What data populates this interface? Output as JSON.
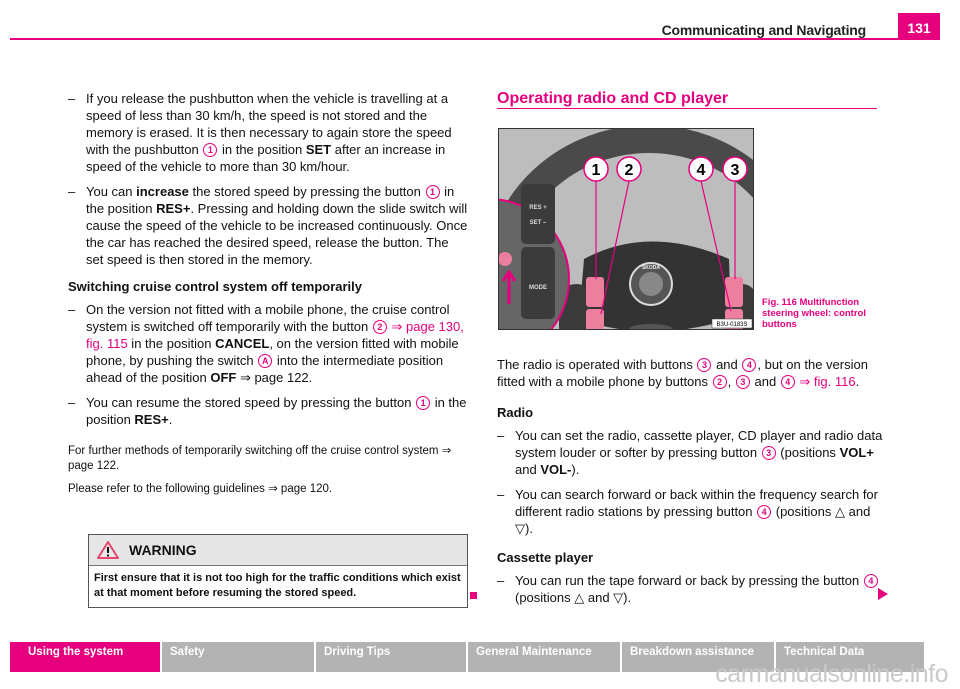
{
  "header": {
    "title": "Communicating and Navigating",
    "page_number": "131",
    "accent_color": "#e6007e"
  },
  "left": {
    "bullets_top": [
      {
        "parts": [
          "If you release the pushbutton when the vehicle is travelling at a speed of less than 30 km/h, the speed is not stored and the memory is erased. It is then necessary to again store the speed with the pushbutton ",
          "1",
          " in the position ",
          "SET",
          " after an increase in speed of the vehicle to more than 30 km/hour."
        ]
      },
      {
        "parts": [
          "You can ",
          "increase",
          " the stored speed by pressing the button ",
          "1",
          " in the position ",
          "RES+",
          ". Pressing and holding down the slide switch will cause the speed of the vehicle to be increased continuously. Once the car has reached the desired speed, release the button. The set speed is then stored in the memory."
        ]
      }
    ],
    "subheading": "Switching cruise control system off temporarily",
    "bullets_cruise": [
      {
        "parts": [
          "On the version not fitted with a mobile phone, the cruise control system is switched off temporarily with the button ",
          "2",
          " ",
          "⇒ page 130, fig. 115",
          " in the position ",
          "CANCEL",
          ", on the version fitted with mobile phone, by pushing the switch ",
          "A",
          " into the intermediate position ahead of the position ",
          "OFF",
          " ⇒ page 122."
        ]
      },
      {
        "parts": [
          "You can resume the stored speed by pressing the button ",
          "1",
          " in the position ",
          "RES+",
          "."
        ]
      }
    ],
    "note1": "For further methods of temporarily switching off the cruise control system ⇒ page 122.",
    "note2": "Please refer to the following guidelines ⇒ page 120.",
    "warning": {
      "icon": "warning-triangle-icon",
      "title": "WARNING",
      "body": "First ensure that it is not too high for the traffic conditions which exist at that moment before resuming the stored speed."
    }
  },
  "right": {
    "section_title": "Operating radio and CD player",
    "figure": {
      "callouts": [
        "1",
        "2",
        "4",
        "3"
      ],
      "inset_labels": [
        "RES +",
        "SET –",
        "MODE"
      ],
      "logo_text": "SKODA",
      "code": "B3U-0183S",
      "caption": "Fig. 116   Multifunction steering wheel: control buttons"
    },
    "intro_parts": [
      "The radio is operated with buttons ",
      "3",
      " and ",
      "4",
      ", but on the version fitted with a mobile phone by buttons ",
      "2",
      ", ",
      "3",
      " and ",
      "4",
      " ",
      "⇒ fig. 116",
      "."
    ],
    "radio_heading": "Radio",
    "radio_bullets": [
      {
        "parts": [
          "You can set the radio, cassette player, CD player and radio data system louder or softer by pressing button ",
          "3",
          " (positions ",
          "VOL+",
          " and ",
          "VOL-",
          ")."
        ]
      },
      {
        "parts": [
          "You can search forward or back within the frequency search for different radio stations by pressing button ",
          "4",
          " (positions △ and ▽)."
        ]
      }
    ],
    "cassette_heading": "Cassette player",
    "cassette_bullets": [
      {
        "parts": [
          "You can run the tape forward or back by pressing the button ",
          "4",
          " (positions △ and ▽)."
        ]
      }
    ]
  },
  "footer": {
    "tabs": [
      "Using the system",
      "Safety",
      "Driving Tips",
      "General Maintenance",
      "Breakdown assistance",
      "Technical Data"
    ],
    "active_tab": "Using the system",
    "watermark": "carmanualsonline.info"
  }
}
